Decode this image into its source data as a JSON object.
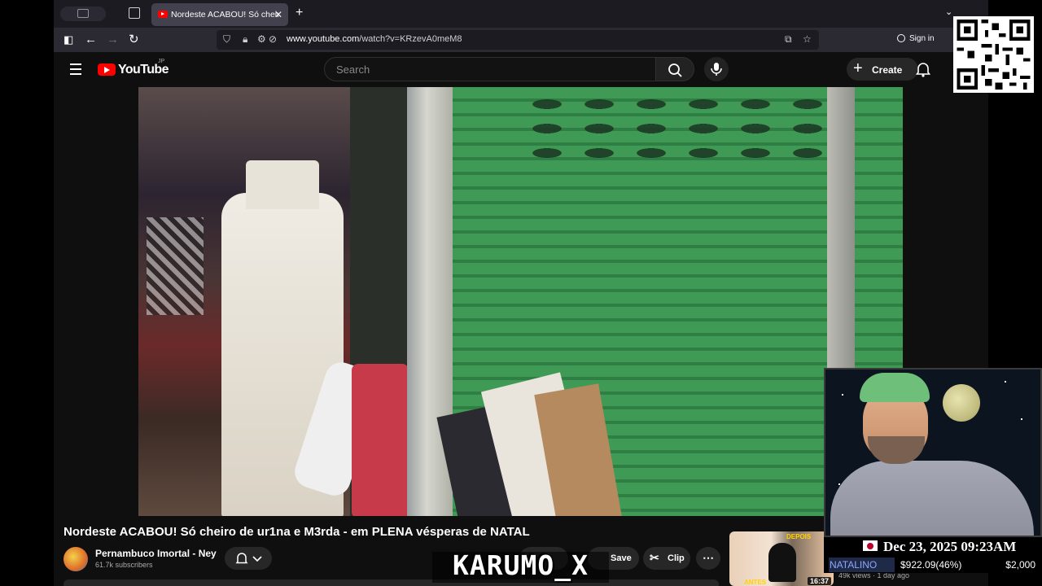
{
  "browser": {
    "tab_title": "Nordeste ACABOU! Só cheiro de",
    "url_host": "www.youtube.com",
    "url_path": "/watch?v=KRzevA0meM8",
    "sign_in_label": "Sign in"
  },
  "youtube": {
    "logo_text": "YouTube",
    "country_code": "JP",
    "search_placeholder": "Search",
    "create_label": "Create"
  },
  "video": {
    "title": "Nordeste ACABOU! Só cheiro de ur1na e M3rda - em PLENA vésperas de NATAL",
    "channel_name": "Pernambuco Imortal - Ney",
    "subscribers": "61.7k subscribers",
    "actions": {
      "save_label": "Save",
      "clip_label": "Clip"
    }
  },
  "recommended": {
    "label_after": "DEPOIS",
    "label_before": "ANTES",
    "duration": "16:37",
    "meta": "49k views · 1 day ago"
  },
  "overlay": {
    "watermark": "KARUMO_X",
    "datetime": "Dec 23, 2025 09:23AM",
    "donation": {
      "symbol": "NATALINO",
      "amount": "$922.09(46%)",
      "goal": "$2,000",
      "progress": 0.46
    }
  },
  "colors": {
    "youtube_red": "#ff0000",
    "shutter_green": "#3f9a55",
    "ticker_blue": "#8ea6ff"
  }
}
